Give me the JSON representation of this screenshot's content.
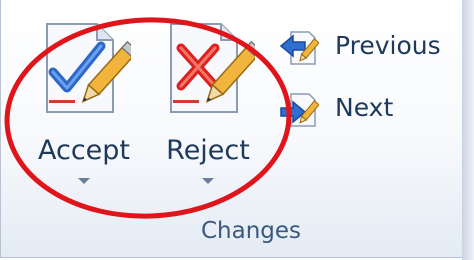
{
  "group": {
    "label": "Changes"
  },
  "buttons": {
    "accept": {
      "label": "Accept",
      "icon": "accept-change-icon"
    },
    "reject": {
      "label": "Reject",
      "icon": "reject-change-icon"
    },
    "previous": {
      "label": "Previous",
      "icon": "previous-change-icon"
    },
    "next": {
      "label": "Next",
      "icon": "next-change-icon"
    }
  },
  "colors": {
    "label_text": "#1e395b",
    "group_label_text": "#3b587f",
    "annotation_circle": "#e0141b",
    "check_blue": "#2c67c9",
    "cross_red": "#e0201e"
  },
  "annotation": {
    "shape": "ellipse",
    "encloses": [
      "accept",
      "reject"
    ]
  }
}
